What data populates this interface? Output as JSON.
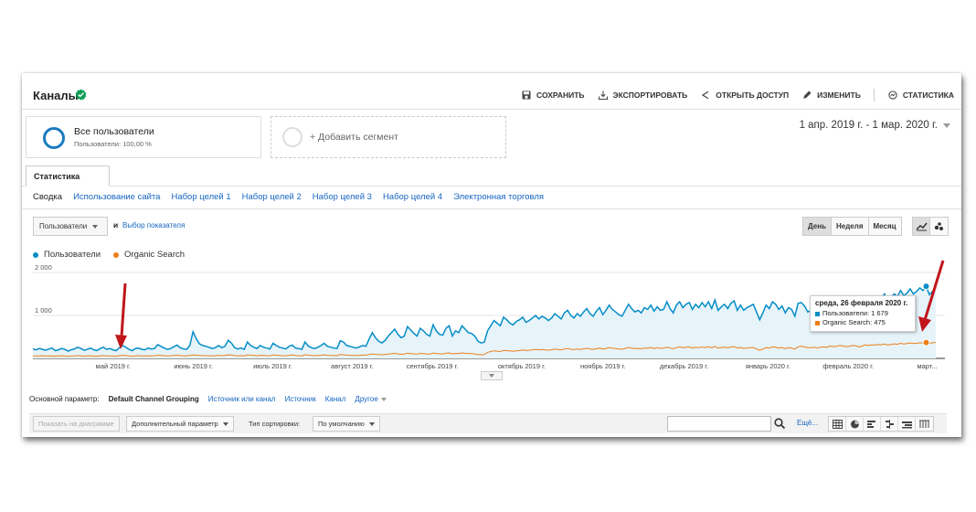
{
  "header": {
    "title": "Каналы",
    "actions": [
      {
        "icon": "save-icon",
        "label": "СОХРАНИТЬ"
      },
      {
        "icon": "export-icon",
        "label": "ЭКСПОРТИРОВАТЬ"
      },
      {
        "icon": "share-icon",
        "label": "ОТКРЫТЬ ДОСТУП"
      },
      {
        "icon": "pencil-icon",
        "label": "ИЗМЕНИТЬ"
      },
      {
        "icon": "insights-icon",
        "label": "СТАТИСТИКА"
      }
    ]
  },
  "segments": {
    "current_name": "Все пользователи",
    "current_sub": "Пользователи: 100,00 %",
    "add_label": "+ Добавить сегмент"
  },
  "date_range": "1 апр. 2019 г. - 1 мар. 2020 г.",
  "tab": "Статистика",
  "subnav": [
    "Сводка",
    "Использование сайта",
    "Набор целей 1",
    "Набор целей 2",
    "Набор целей 3",
    "Набор целей 4",
    "Электронная торговля"
  ],
  "metric": {
    "selected": "Пользователи",
    "and": "и",
    "pick": "Выбор показателя"
  },
  "period": {
    "day": "День",
    "week": "Неделя",
    "month": "Месяц"
  },
  "legend": {
    "series1": "Пользователи",
    "series2": "Organic Search"
  },
  "colors": {
    "users": "#058dc7",
    "organic": "#ed7e17",
    "area": "#e6f4fa",
    "link": "#1565c0"
  },
  "tooltip": {
    "date": "среда, 26 февраля 2020 г.",
    "users": "Пользователи: 1 679",
    "organic": "Organic Search: 475"
  },
  "dimension": {
    "label": "Основной параметр:",
    "current": "Default Channel Grouping",
    "links": [
      "Источник или канал",
      "Источник",
      "Канал"
    ],
    "other": "Другое"
  },
  "table_toolbar": {
    "plot_rows": "Показать на диаграмме",
    "secondary": "Дополнительный параметр",
    "sort_label": "Тип сортировки:",
    "sort_value": "По умолчанию",
    "more": "Ещё..."
  },
  "chart_data": {
    "type": "line",
    "x_start": "2019-04-01",
    "x_end": "2020-03-01",
    "ylim": [
      0,
      2000
    ],
    "yticks": [
      "2 000",
      "1 000"
    ],
    "xticks": [
      "май 2019 г.",
      "июнь 2019 г.",
      "июль 2019 г.",
      "август 2019 г.",
      "сентябрь 2019 г.",
      "октябрь 2019 г.",
      "ноябрь 2019 г.",
      "декабрь 2019 г.",
      "январь 2020 г.",
      "февраль 2020 г.",
      "март..."
    ],
    "grid": true,
    "legend_position": "top-left",
    "series": [
      {
        "name": "Пользователи",
        "color": "#058dc7",
        "values": [
          220,
          200,
          230,
          210,
          190,
          220,
          240,
          180,
          200,
          230,
          210,
          170,
          200,
          220,
          260,
          230,
          190,
          210,
          240,
          200,
          180,
          230,
          260,
          210,
          230,
          200,
          180,
          250,
          300,
          260,
          210,
          180,
          230,
          240,
          210,
          200,
          240,
          220,
          230,
          320,
          280,
          240,
          210,
          230,
          270,
          310,
          250,
          220,
          210,
          300,
          620,
          460,
          340,
          300,
          280,
          260,
          230,
          250,
          300,
          250,
          280,
          420,
          360,
          250,
          220,
          240,
          210,
          380,
          300,
          260,
          230,
          300,
          260,
          240,
          220,
          350,
          300,
          260,
          240,
          220,
          280,
          310,
          240,
          230,
          210,
          380,
          290,
          250,
          230,
          260,
          300,
          350,
          280,
          260,
          240,
          230,
          410,
          380,
          300,
          280,
          260,
          240,
          270,
          300,
          280,
          450,
          600,
          480,
          400,
          360,
          420,
          520,
          600,
          680,
          560,
          480,
          520,
          740,
          660,
          580,
          520,
          700,
          640,
          560,
          520,
          780,
          640,
          560,
          540,
          700,
          760,
          520,
          640,
          600,
          760,
          680,
          600,
          580,
          520,
          400,
          360,
          380,
          640,
          760,
          880,
          820,
          760,
          960,
          900,
          820,
          780,
          860,
          900,
          960,
          840,
          880,
          940,
          1000,
          920,
          980,
          940,
          880,
          940,
          1040,
          980,
          920,
          1060,
          1120,
          1000,
          940,
          1040,
          980,
          1080,
          1160,
          1040,
          980,
          1100,
          1180,
          1020,
          1120,
          1240,
          1140,
          1080,
          1020,
          980,
          1120,
          1260,
          1160,
          1080,
          1120,
          1060,
          1180,
          1140,
          1240,
          1100,
          1200,
          1120,
          1140,
          1320,
          1160,
          1060,
          1240,
          1320,
          1180,
          1260,
          1300,
          1140,
          1260,
          1180,
          1300,
          1200,
          1320,
          1160,
          1360,
          1120,
          1200,
          1260,
          1160,
          1280,
          1340,
          1120,
          1240,
          1120,
          1180,
          1220,
          1260,
          1080,
          900,
          1060,
          1240,
          1160,
          1320,
          1260,
          1140,
          1220,
          1060,
          1180,
          1140,
          980,
          1280,
          1300,
          1220,
          1080,
          1120,
          1160,
          1060,
          1180,
          1200,
          1120,
          1320,
          1220,
          1280,
          1360,
          1280,
          1160,
          1240,
          1340,
          1300,
          1120,
          1260,
          1400,
          1300,
          1420,
          1340,
          1440,
          1400,
          1500,
          1320,
          1420,
          1500,
          1440,
          1580,
          1460,
          1520,
          1620,
          1500,
          1560,
          1640,
          1580,
          1679,
          1480,
          1560,
          1640
        ],
        "highlight": {
          "date": "2020-02-26",
          "value": 1679
        }
      },
      {
        "name": "Organic Search",
        "color": "#ed7e17",
        "values": [
          60,
          55,
          58,
          62,
          57,
          55,
          60,
          52,
          58,
          62,
          56,
          50,
          55,
          60,
          66,
          60,
          54,
          58,
          62,
          56,
          52,
          60,
          66,
          58,
          60,
          56,
          52,
          64,
          72,
          66,
          58,
          52,
          60,
          64,
          58,
          56,
          62,
          60,
          62,
          74,
          70,
          64,
          58,
          62,
          68,
          74,
          66,
          60,
          58,
          70,
          80,
          76,
          70,
          66,
          64,
          62,
          60,
          64,
          72,
          64,
          68,
          84,
          80,
          66,
          62,
          64,
          60,
          82,
          74,
          68,
          62,
          72,
          68,
          64,
          62,
          80,
          74,
          68,
          64,
          62,
          72,
          78,
          66,
          64,
          60,
          88,
          76,
          70,
          64,
          68,
          74,
          82,
          72,
          68,
          66,
          64,
          90,
          86,
          76,
          72,
          70,
          66,
          72,
          78,
          74,
          92,
          104,
          96,
          90,
          86,
          92,
          100,
          108,
          116,
          104,
          96,
          100,
          120,
          112,
          106,
          100,
          118,
          112,
          104,
          100,
          126,
          114,
          106,
          104,
          120,
          128,
          104,
          116,
          112,
          128,
          120,
          114,
          112,
          104,
          90,
          86,
          90,
          140,
          160,
          176,
          168,
          160,
          188,
          180,
          172,
          166,
          176,
          184,
          196,
          184,
          190,
          200,
          210,
          198,
          206,
          200,
          192,
          200,
          216,
          206,
          198,
          220,
          230,
          212,
          204,
          216,
          208,
          224,
          236,
          218,
          210,
          226,
          240,
          216,
          232,
          250,
          236,
          228,
          218,
          212,
          232,
          256,
          240,
          228,
          232,
          224,
          242,
          236,
          252,
          230,
          246,
          234,
          238,
          264,
          240,
          226,
          252,
          268,
          246,
          260,
          266,
          240,
          258,
          248,
          266,
          252,
          272,
          244,
          278,
          240,
          252,
          262,
          246,
          264,
          276,
          240,
          256,
          232,
          240,
          248,
          256,
          220,
          190,
          218,
          252,
          240,
          268,
          260,
          240,
          254,
          226,
          246,
          240,
          214,
          272,
          280,
          268,
          246,
          252,
          260,
          242,
          262,
          268,
          256,
          290,
          274,
          284,
          300,
          290,
          272,
          284,
          300,
          296,
          264,
          290,
          312,
          300,
          320,
          308,
          324,
          318,
          334,
          310,
          324,
          338,
          330,
          350,
          336,
          344,
          360,
          344,
          352,
          364,
          356,
          370,
          352,
          364,
          372
        ]
      }
    ]
  }
}
